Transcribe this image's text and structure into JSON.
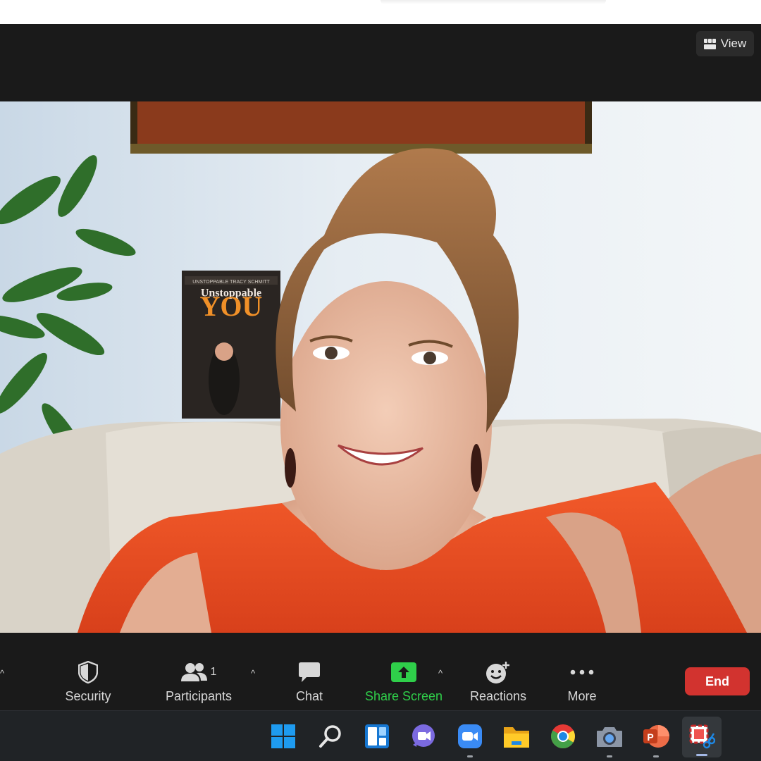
{
  "header": {
    "view_label": "View"
  },
  "video": {
    "book_series": "UNSTOPPABLE TRACY SCHMITT",
    "book_title_line1": "Unstoppable",
    "book_title_line2": "YOU"
  },
  "toolbar": {
    "security": "Security",
    "participants": "Participants",
    "participants_count": "1",
    "chat": "Chat",
    "share_screen": "Share Screen",
    "reactions": "Reactions",
    "more": "More",
    "end": "End"
  },
  "taskbar": {
    "apps": [
      "start-icon",
      "search-icon",
      "widgets-icon",
      "teams-chat-icon",
      "zoom-icon",
      "file-explorer-icon",
      "chrome-icon",
      "camera-icon",
      "powerpoint-icon",
      "snipping-tool-icon"
    ]
  },
  "colors": {
    "toolbar_bg": "#1a1a1a",
    "share_green": "#2fcf4a",
    "end_red": "#d2332f",
    "taskbar_bg": "#202326"
  }
}
